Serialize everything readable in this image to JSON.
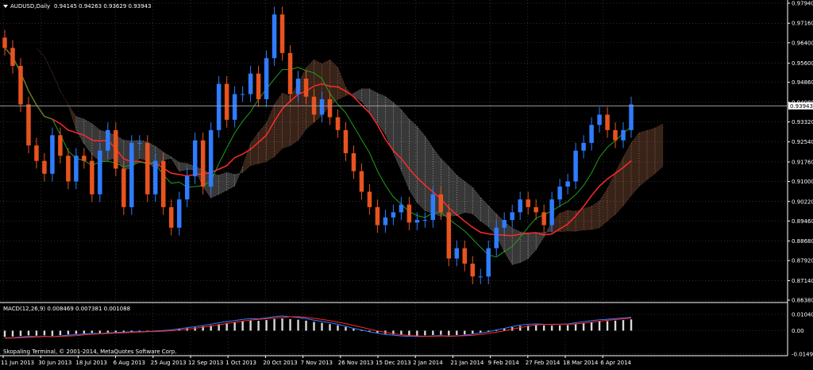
{
  "chart_data": [
    {
      "type": "line",
      "title": "AUDUSD,Daily",
      "ohlc_header": "0.94145 0.94263 0.93629 0.93943",
      "last_price_label": "0.93943",
      "last_price": 0.93943,
      "ylim": [
        0.8638,
        0.9794
      ],
      "y_tick_labels": [
        "0.97940",
        "0.97160",
        "0.96400",
        "0.95600",
        "0.94860",
        "0.94080",
        "0.93320",
        "0.92540",
        "0.91760",
        "0.91000",
        "0.90220",
        "0.89460",
        "0.88680",
        "0.87920",
        "0.87140",
        "0.86380"
      ],
      "x_tick_labels": [
        "11 Jun 2013",
        "30 Jun 2013",
        "18 Jul 2013",
        "6 Aug 2013",
        "25 Aug 2013",
        "12 Sep 2013",
        "1 Oct 2013",
        "20 Oct 2013",
        "7 Nov 2013",
        "26 Nov 2013",
        "15 Dec 2013",
        "2 Jan 2014",
        "21 Jan 2014",
        "9 Feb 2014",
        "27 Feb 2014",
        "18 Mar 2014",
        "6 Apr 2014"
      ],
      "grid": true,
      "colors": {
        "background": "#000000",
        "grid": "#5a5a5a",
        "bull": "#2f7cff",
        "bear": "#e8531f",
        "ma_slow": "#ff2a2a",
        "ma_fast": "#1e9e1e",
        "cloud_bull": "#ffffff",
        "cloud_bear": "#ffa070",
        "text": "#ffffff"
      },
      "series": [
        {
          "values": [
            0.962,
            0.955,
            0.94,
            0.924,
            0.918,
            0.913,
            0.928,
            0.92,
            0.91,
            0.92,
            0.918,
            0.905,
            0.922,
            0.93,
            0.915,
            0.9,
            0.925,
            0.925,
            0.905,
            0.918,
            0.9,
            0.892,
            0.903,
            0.912,
            0.926,
            0.908,
            0.93,
            0.948,
            0.934,
            0.944,
            0.944,
            0.952,
            0.942,
            0.958,
            0.975,
            0.96,
            0.944,
            0.95,
            0.943,
            0.936,
            0.942,
            0.935,
            0.93,
            0.921,
            0.914,
            0.906,
            0.9,
            0.893,
            0.896,
            0.898,
            0.901,
            0.894,
            0.895,
            0.895,
            0.905,
            0.898,
            0.88,
            0.884,
            0.878,
            0.873,
            0.873,
            0.884,
            0.892,
            0.895,
            0.898,
            0.903,
            0.9,
            0.898,
            0.893,
            0.903,
            0.908,
            0.91,
            0.922,
            0.925,
            0.932,
            0.936,
            0.93,
            0.926,
            0.93,
            0.94
          ]
        }
      ]
    },
    {
      "type": "bar",
      "title": "MACD(12,26,9) 0.008469 0.007381 0.001088",
      "ylim": [
        -0.0155,
        0.0175
      ],
      "y_tick_labels": [
        "0.010400",
        "0.00",
        "-0.014900"
      ],
      "series": [
        {
          "values": [
            -0.004,
            -0.0038,
            -0.0034,
            -0.003,
            -0.0032,
            -0.003,
            -0.0033,
            -0.0028,
            -0.0024,
            -0.002,
            -0.0018,
            -0.0014,
            -0.0016,
            -0.0012,
            -0.001,
            -0.0008,
            -0.0006,
            -0.0005,
            -0.0004,
            -0.0002,
            0.0001,
            0.0004,
            0.001,
            0.0016,
            0.0021,
            0.0028,
            0.0034,
            0.0042,
            0.0049,
            0.0054,
            0.006,
            0.0064,
            0.0063,
            0.0068,
            0.0075,
            0.0078,
            0.0074,
            0.007,
            0.0064,
            0.0056,
            0.005,
            0.0042,
            0.0034,
            0.0024,
            0.0012,
            0.0004,
            -0.0006,
            -0.0014,
            -0.002,
            -0.0024,
            -0.0028,
            -0.003,
            -0.0031,
            -0.003,
            -0.0028,
            -0.0026,
            -0.003,
            -0.0028,
            -0.0024,
            -0.0018,
            -0.0012,
            -0.0006,
            0.0004,
            0.0012,
            0.0022,
            0.003,
            0.0034,
            0.0036,
            0.0034,
            0.0032,
            0.0034,
            0.0036,
            0.0042,
            0.0048,
            0.0054,
            0.0058,
            0.0061,
            0.0064,
            0.0068,
            0.0072
          ]
        }
      ]
    }
  ],
  "copyright": "Skopaling Terminal, © 2001-2014, MetaQuotes Software Corp."
}
